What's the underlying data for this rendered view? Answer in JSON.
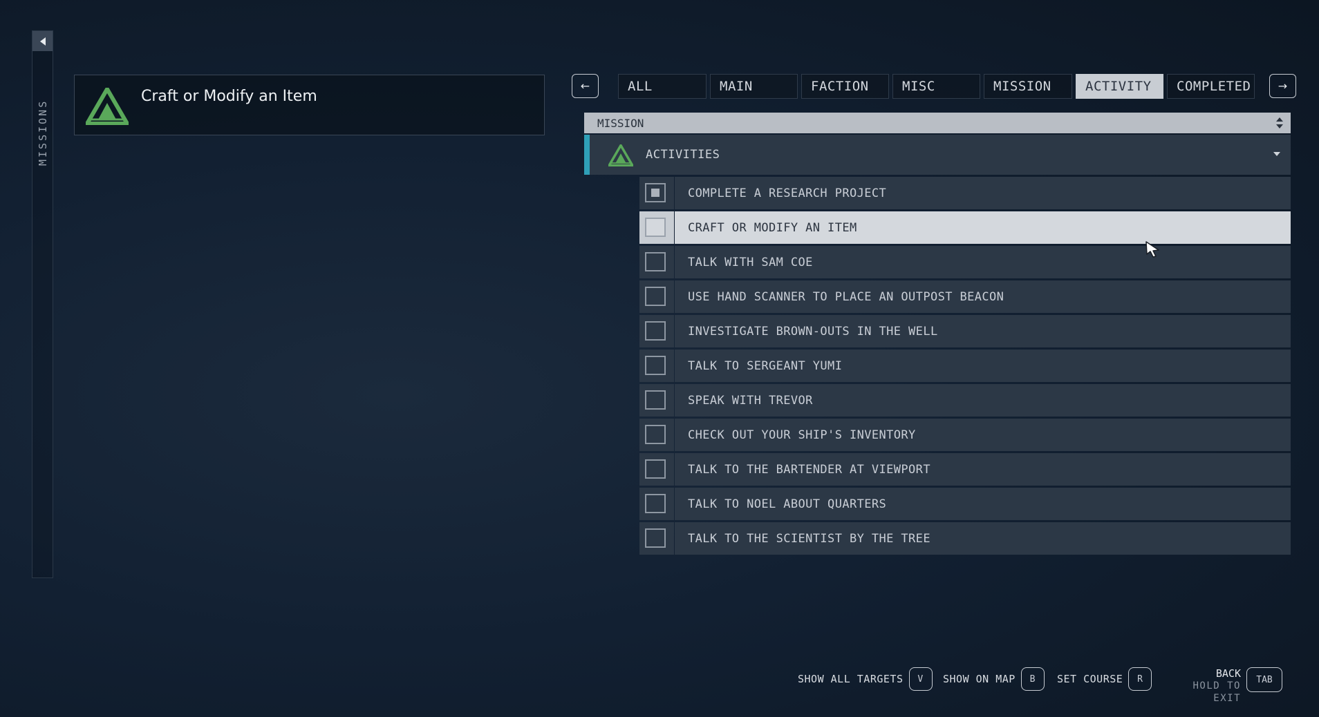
{
  "sidebar": {
    "label": "MISSIONS"
  },
  "selected_mission": {
    "title": "Craft or Modify an Item"
  },
  "tabs": [
    {
      "label": "ALL",
      "active": false
    },
    {
      "label": "MAIN",
      "active": false
    },
    {
      "label": "FACTION",
      "active": false
    },
    {
      "label": "MISC",
      "active": false
    },
    {
      "label": "MISSION",
      "active": false
    },
    {
      "label": "ACTIVITY",
      "active": true
    },
    {
      "label": "COMPLETED",
      "active": false
    }
  ],
  "nav": {
    "prev": "←",
    "next": "→"
  },
  "sort": {
    "label": "MISSION"
  },
  "category": {
    "label": "ACTIVITIES"
  },
  "missions": [
    {
      "label": "COMPLETE A RESEARCH PROJECT",
      "checked": true,
      "selected": false
    },
    {
      "label": "CRAFT OR MODIFY AN ITEM",
      "checked": false,
      "selected": true
    },
    {
      "label": "TALK WITH SAM COE",
      "checked": false,
      "selected": false
    },
    {
      "label": "USE HAND SCANNER TO PLACE AN OUTPOST BEACON",
      "checked": false,
      "selected": false
    },
    {
      "label": "INVESTIGATE BROWN-OUTS IN THE WELL",
      "checked": false,
      "selected": false
    },
    {
      "label": "TALK TO SERGEANT YUMI",
      "checked": false,
      "selected": false
    },
    {
      "label": "SPEAK WITH TREVOR",
      "checked": false,
      "selected": false
    },
    {
      "label": "CHECK OUT YOUR SHIP'S INVENTORY",
      "checked": false,
      "selected": false
    },
    {
      "label": "TALK TO THE BARTENDER AT VIEWPORT",
      "checked": false,
      "selected": false
    },
    {
      "label": "TALK TO NOEL ABOUT QUARTERS",
      "checked": false,
      "selected": false
    },
    {
      "label": "TALK TO THE SCIENTIST BY THE TREE",
      "checked": false,
      "selected": false
    }
  ],
  "footer": {
    "show_all_targets": {
      "label": "SHOW ALL TARGETS",
      "key": "V"
    },
    "show_on_map": {
      "label": "SHOW ON MAP",
      "key": "B"
    },
    "set_course": {
      "label": "SET COURSE",
      "key": "R"
    },
    "back": {
      "label": "BACK",
      "sub": "HOLD TO EXIT",
      "key": "TAB"
    }
  },
  "colors": {
    "accent_teal": "#2fa0b8",
    "logo_green": "#5aa85a",
    "row_bg": "#2c3846",
    "selected_bg": "#d4d8dd"
  }
}
